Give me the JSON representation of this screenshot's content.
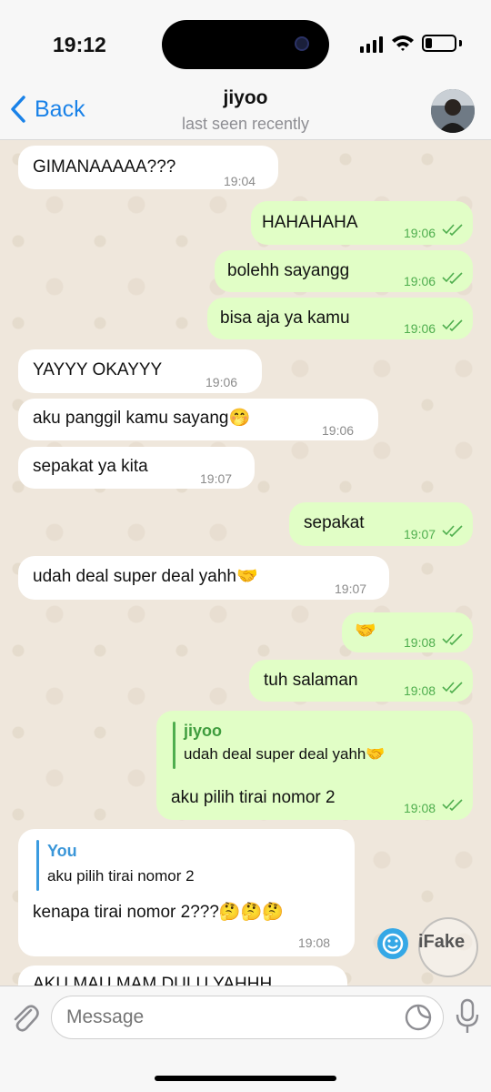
{
  "status_bar": {
    "time": "19:12"
  },
  "header": {
    "back_label": "Back",
    "contact_name": "jiyoo",
    "contact_status": "last seen recently"
  },
  "messages": [
    {
      "dir": "in",
      "text": "GIMANAAAAA???",
      "time": "19:04"
    },
    {
      "dir": "out",
      "text": "HAHAHAHA",
      "time": "19:06"
    },
    {
      "dir": "out",
      "text": "bolehh sayangg",
      "time": "19:06"
    },
    {
      "dir": "out",
      "text": "bisa aja ya kamu",
      "time": "19:06"
    },
    {
      "dir": "in",
      "text": "YAYYY OKAYYY",
      "time": "19:06"
    },
    {
      "dir": "in",
      "text": "aku panggil kamu sayang🤭",
      "time": "19:06"
    },
    {
      "dir": "in",
      "text": "sepakat ya kita",
      "time": "19:07"
    },
    {
      "dir": "out",
      "text": "sepakat",
      "time": "19:07"
    },
    {
      "dir": "in",
      "text": "udah deal super deal yahh🤝",
      "time": "19:07"
    },
    {
      "dir": "out",
      "text": "🤝",
      "time": "19:08"
    },
    {
      "dir": "out",
      "text": "tuh salaman",
      "time": "19:08"
    },
    {
      "dir": "out",
      "reply_name": "jiyoo",
      "reply_text": "udah deal super deal yahh🤝",
      "text": "aku pilih tirai nomor 2",
      "time": "19:08"
    },
    {
      "dir": "in",
      "reply_name": "You",
      "reply_text": "aku pilih tirai nomor 2",
      "text": "kenapa tirai nomor 2???🤔🤔🤔",
      "time": "19:08"
    },
    {
      "dir": "in",
      "text": "AKU MAU MAM DULU YAHHH",
      "time": ""
    }
  ],
  "watermark": {
    "text": "iFake"
  },
  "input": {
    "placeholder": "Message"
  },
  "colors": {
    "accent": "#1a82e8",
    "outgoing_bubble": "#e1fec6",
    "incoming_bubble": "#ffffff",
    "tick_green": "#4fae4e"
  }
}
